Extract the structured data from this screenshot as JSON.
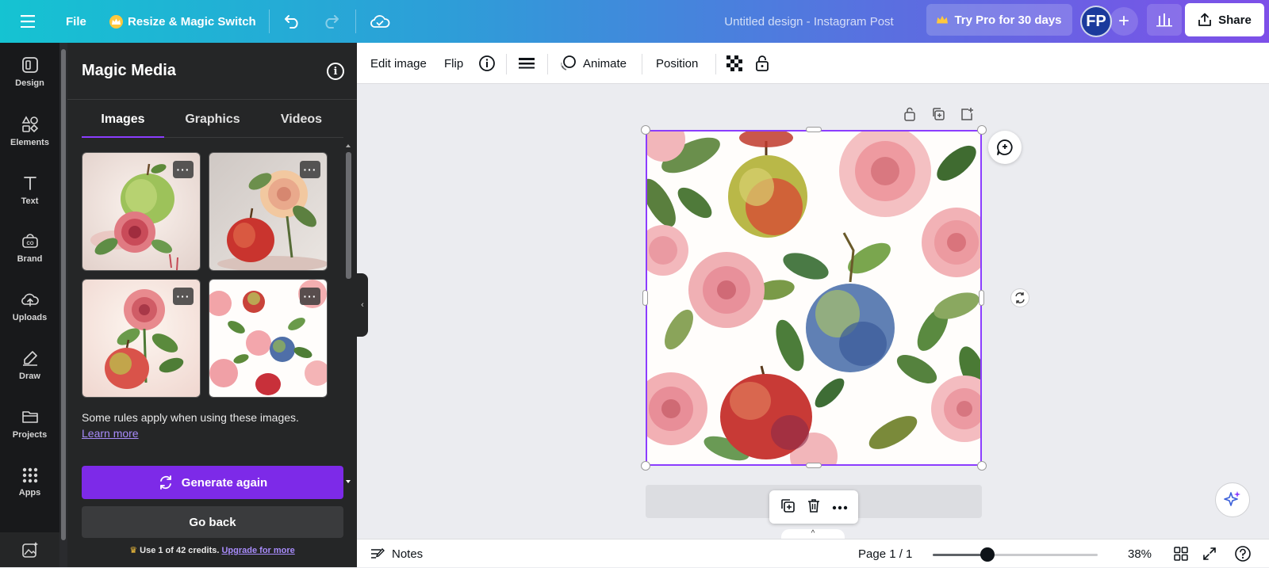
{
  "topbar": {
    "file_label": "File",
    "resize_label": "Resize & Magic Switch",
    "title": "Untitled design - Instagram Post",
    "try_pro_label": "Try Pro for 30 days",
    "avatar_initials": "FP",
    "share_label": "Share"
  },
  "rail": {
    "items": [
      {
        "label": "Design",
        "icon": "design-icon"
      },
      {
        "label": "Elements",
        "icon": "elements-icon"
      },
      {
        "label": "Text",
        "icon": "text-icon"
      },
      {
        "label": "Brand",
        "icon": "brand-icon"
      },
      {
        "label": "Uploads",
        "icon": "upload-cloud-icon"
      },
      {
        "label": "Draw",
        "icon": "pen-icon"
      },
      {
        "label": "Projects",
        "icon": "folder-icon"
      },
      {
        "label": "Apps",
        "icon": "apps-grid-icon"
      }
    ]
  },
  "panel": {
    "title": "Magic Media",
    "tabs": [
      "Images",
      "Graphics",
      "Videos"
    ],
    "active_tab": "Images",
    "rules_text": "Some rules apply when using these images.",
    "learn_more": "Learn more",
    "generate_again": "Generate again",
    "go_back": "Go back",
    "credits_text": "Use 1 of 42 credits.",
    "upgrade_link": "Upgrade for more"
  },
  "toolbar": {
    "edit_image": "Edit image",
    "flip": "Flip",
    "animate": "Animate",
    "position": "Position"
  },
  "bottom": {
    "notes": "Notes",
    "page": "Page 1 / 1",
    "zoom": "38%",
    "zoom_slider_fraction": 0.33
  },
  "colors": {
    "accent": "#8b3dff",
    "generate_button": "#7d2ae8",
    "topbar_start": "#15c3d2",
    "topbar_end": "#7d4fe8"
  }
}
